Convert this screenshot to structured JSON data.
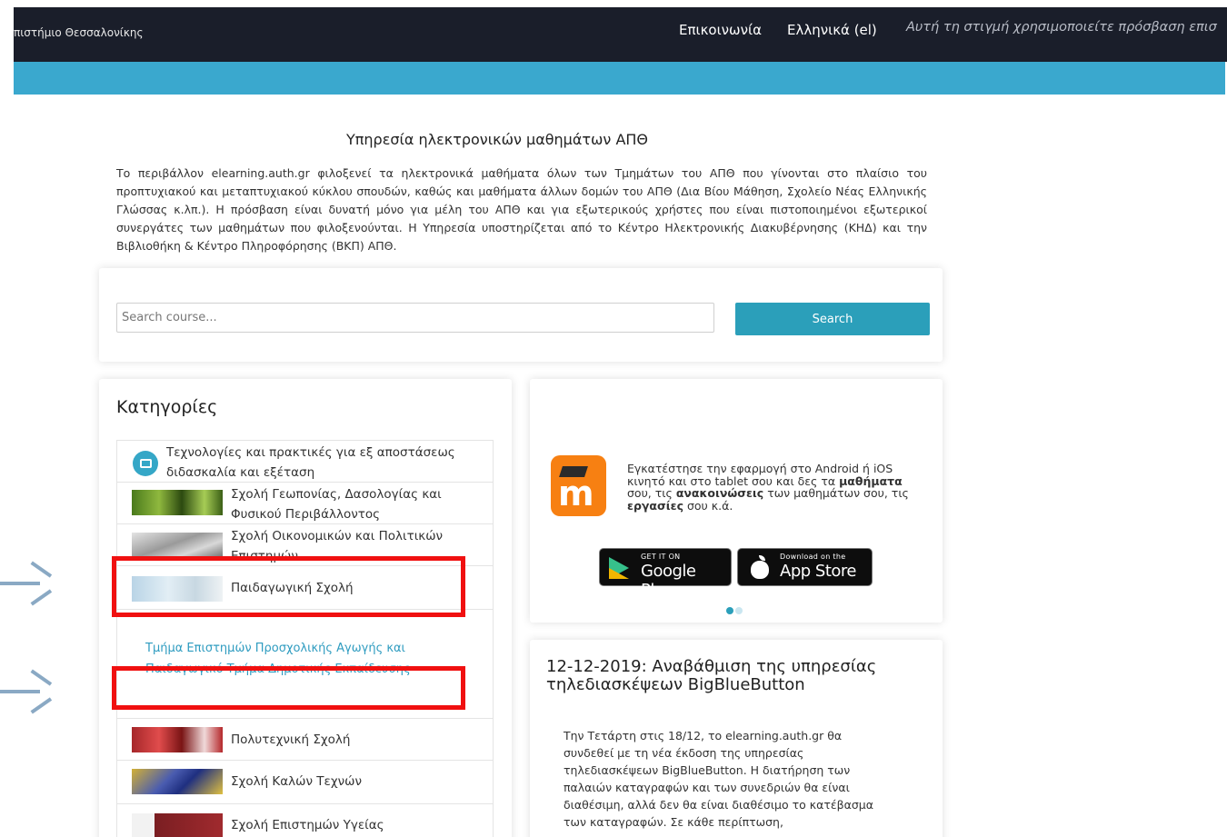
{
  "topbar": {
    "brand": "πιστήμιο Θεσσαλονίκης",
    "contact": "Επικοινωνία",
    "language": "Ελληνικά (el)",
    "access_note": "Αυτή τη στιγμή χρησιμοποιείτε πρόσβαση επισ"
  },
  "main": {
    "title": "Υπηρεσία ηλεκτρονικών μαθημάτων ΑΠΘ",
    "intro": "Το περιβάλλον elearning.auth.gr φιλοξενεί τα ηλεκτρονικά μαθήματα όλων των Τμημάτων του ΑΠΘ που γίνονται στο πλαίσιο του προπτυχιακού και μεταπτυχιακού κύκλου σπουδών, καθώς και μαθήματα άλλων δομών του ΑΠΘ (Δια Βίου Μάθηση, Σχολείο Νέας Ελληνικής Γλώσσας κ.λπ.). Η πρόσβαση είναι δυνατή μόνο για μέλη του ΑΠΘ και για εξωτερικούς χρήστες που είναι πιστοποιημένοι εξωτερικοί συνεργάτες των μαθημάτων που φιλοξενούνται. Η Υπηρεσία υποστηρίζεται από το Κέντρο Ηλεκτρονικής Διακυβέρνησης (ΚΗΔ) και την Βιβλιοθήκη & Κέντρο Πληροφόρησης (ΒΚΠ) ΑΠΘ."
  },
  "search": {
    "placeholder": "Search course...",
    "button_label": "Search"
  },
  "categories": {
    "title": "Κατηγορίες",
    "items": [
      {
        "label": "Τεχνολογίες και πρακτικές για εξ αποστάσεως διδασκαλία και εξέταση"
      },
      {
        "label": "Σχολή Γεωπονίας, Δασολογίας και Φυσικού Περιβάλλοντος"
      },
      {
        "label": "Σχολή Οικονομικών και Πολιτικών Επιστημών"
      },
      {
        "label": "Παιδαγωγική Σχολή"
      },
      {
        "label": "Πολυτεχνική Σχολή"
      },
      {
        "label": "Σχολή Καλών Τεχνών"
      },
      {
        "label": "Σχολή Επιστημών Υγείας"
      }
    ],
    "subitems": [
      {
        "label": "Τμήμα Επιστημών Προσχολικής Αγωγής και Εκπαίδευσης"
      },
      {
        "label": "Παιδαγωγικό Τμήμα Δημοτικής Εκπαίδευσης"
      }
    ]
  },
  "app_promo": {
    "text_1": "Εγκατέστησε την εφαρμογή στο Android ή iOS κινητό και στο tablet σου και δες τα ",
    "bold_1": "μαθήματα",
    "text_2": " σου, τις ",
    "bold_2": "ανακοινώσεις",
    "text_3": " των μαθημάτων σου, τις ",
    "bold_3": "εργασίες",
    "text_4": " σου κ.ά.",
    "google_small": "GET IT ON",
    "google_big": "Google Play",
    "apple_small": "Download on the",
    "apple_big": "App Store"
  },
  "news": {
    "title": "12-12-2019: Αναβάθμιση της υπηρεσίας τηλεδιασκέψεων BigBlueButton",
    "body": "Την Τετάρτη στις 18/12, το elearning.auth.gr θα συνδεθεί με τη νέα έκδοση της υπηρεσίας τηλεδιασκέψεων BigBlueButton. Η διατήρηση των παλαιών καταγραφών και των συνεδριών θα είναι διαθέσιμη, αλλά δεν θα είναι διαθέσιμο το κατέβασμα των καταγραφών. Σε κάθε περίπτωση,"
  },
  "colors": {
    "topbar": "#1a1e2a",
    "accent_bar": "#3aa8ce",
    "search_button": "#2b9fba",
    "link": "#2f9cc0",
    "annotation_red": "#f01010",
    "annotation_arrow": "#8aa9c4",
    "app_logo": "#f78012"
  }
}
